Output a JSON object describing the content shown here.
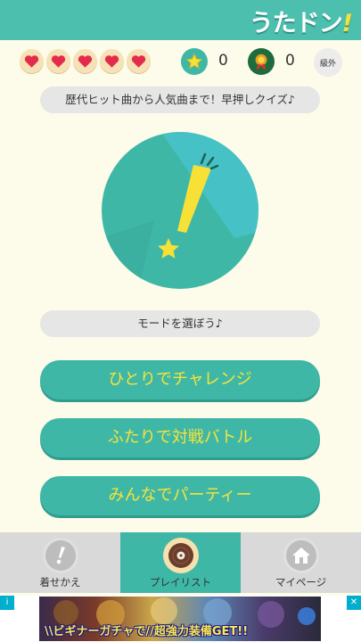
{
  "header": {
    "logo_text": "うたドン",
    "logo_bang": "!"
  },
  "status": {
    "hearts": [
      {
        "icon": "heart-icon",
        "filled": true
      },
      {
        "icon": "heart-icon",
        "filled": true
      },
      {
        "icon": "heart-icon",
        "filled": true
      },
      {
        "icon": "heart-icon",
        "filled": true
      },
      {
        "icon": "heart-icon",
        "filled": true
      }
    ],
    "star_icon": "star-icon",
    "star_count": "0",
    "medal_icon": "medal-icon",
    "medal_count": "0",
    "circle_button_label": "級外"
  },
  "tagline": "歴代ヒット曲から人気曲まで！早押しクイズ♪",
  "hero_icon": "exclamation-star-icon",
  "mode_prompt": "モードを選ぼう♪",
  "modes": {
    "solo": "ひとりでチャレンジ",
    "duo": "ふたりで対戦バトル",
    "party": "みんなでパーティー"
  },
  "tabs": [
    {
      "label": "着せかえ",
      "icon": "exclamation-icon",
      "active": false
    },
    {
      "label": "プレイリスト",
      "icon": "record-icon",
      "active": true
    },
    {
      "label": "マイページ",
      "icon": "house-icon",
      "active": false
    }
  ],
  "ad": {
    "text": "\\\\ビギナーガチャで//超強力装備GET!!",
    "info_icon": "info-icon",
    "close_icon": "close-icon"
  },
  "colors": {
    "header": "#4dbfae",
    "primary": "#3fb7a7",
    "button_text": "#f7e439",
    "background": "#fdfbe9"
  }
}
